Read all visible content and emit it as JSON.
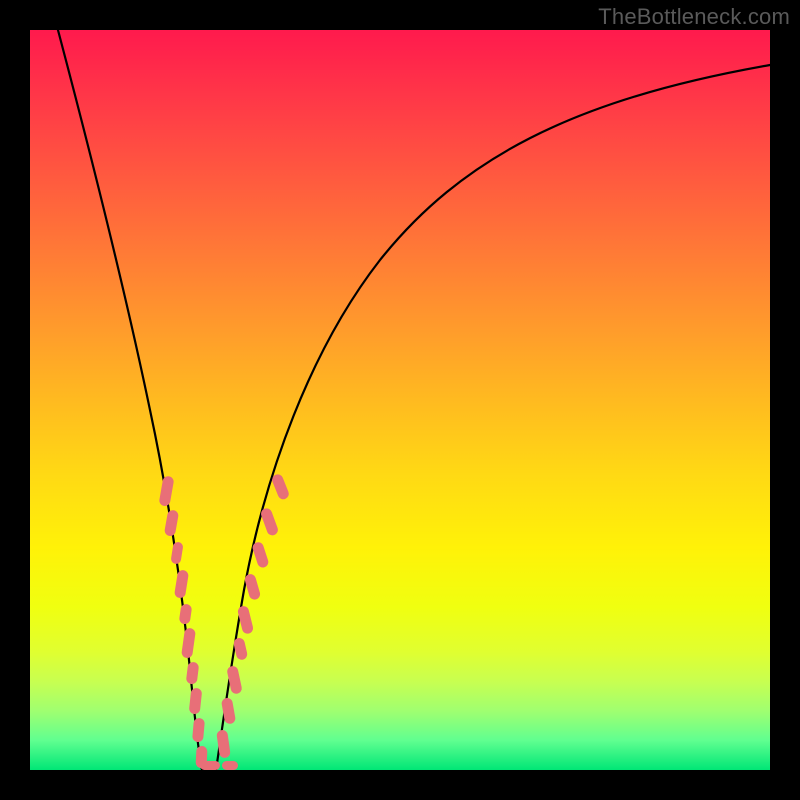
{
  "watermark": "TheBottleneck.com",
  "colors": {
    "frame_bg": "#000000",
    "watermark": "#5a5a5a",
    "curve": "#000000",
    "bead": "#e86f78",
    "gradient_top": "#ff1a4d",
    "gradient_bottom": "#00e676"
  },
  "chart_data": {
    "type": "line",
    "title": "",
    "xlabel": "",
    "ylabel": "",
    "xlim": [
      0,
      100
    ],
    "ylim": [
      0,
      100
    ],
    "grid": false,
    "legend": false,
    "series": [
      {
        "name": "bottleneck-curve",
        "x": [
          0,
          3,
          6,
          9,
          12,
          14,
          16,
          18,
          19,
          20,
          21,
          22,
          23,
          25,
          28,
          32,
          38,
          45,
          55,
          65,
          75,
          85,
          92,
          100
        ],
        "y": [
          102,
          90,
          78,
          66,
          54,
          44,
          34,
          22,
          14,
          6,
          0,
          0,
          4,
          12,
          24,
          38,
          52,
          63,
          74,
          81,
          86,
          90,
          92,
          94
        ]
      }
    ],
    "annotations": {
      "bead_clusters": [
        {
          "side": "left",
          "x_range": [
            14,
            21
          ],
          "y_range": [
            4,
            44
          ]
        },
        {
          "side": "right",
          "x_range": [
            22,
            30
          ],
          "y_range": [
            0,
            40
          ]
        }
      ]
    }
  }
}
